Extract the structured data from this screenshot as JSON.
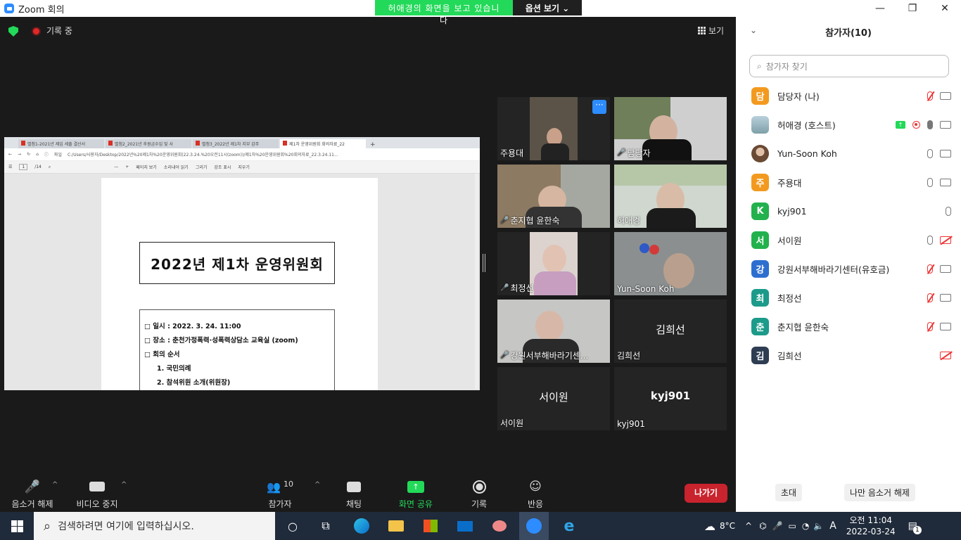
{
  "window": {
    "title": "Zoom 회의",
    "minimize": "—",
    "restore": "❐",
    "close": "✕"
  },
  "share_banner": {
    "viewing": "허애경의 화면을 보고 있습니다",
    "options": "옵션 보기 ⌄"
  },
  "status": {
    "recording": "기록 중",
    "view": "보기"
  },
  "shared_doc": {
    "tabs": [
      "별첨1-2021년 제입 세출 결산서",
      "별첨2_2021년 후원금수입 및 사",
      "별첨3_2022년 제1차 지부 감주",
      "제1차 운영위원회 회의자료_22"
    ],
    "address": "C:/Users/사용자/Desktop/2022년%20제1차%20운영위원회(22.3.24.%20오전11시(zoom))/제1차%20운영위원회%20회의자료_22.3.24.11...",
    "file_label": "파일",
    "page_num": "1",
    "page_total": "/14",
    "tools": [
      "페이지 보기",
      "소리내어 읽기",
      "그리기",
      "강조 표시",
      "지우기"
    ],
    "title": "2022년 제1차 운영위원회",
    "lines": [
      {
        "text": "□ 일시 : 2022. 3. 24. 11:00",
        "indent": false
      },
      {
        "text": "□ 장소 : 춘천가정폭력·성폭력상담소 교육실 (zoom)",
        "indent": false
      },
      {
        "text": "□ 회의 순서",
        "indent": false
      },
      {
        "text": "1. 국민의례",
        "indent": true
      },
      {
        "text": "2. 참석위원 소개(위원장)",
        "indent": true
      }
    ]
  },
  "tiles": [
    {
      "name": "주용대",
      "muted": false
    },
    {
      "name": "담당자",
      "muted": true
    },
    {
      "name": "춘지협 윤한숙",
      "muted": true
    },
    {
      "name": "허애경",
      "muted": false
    },
    {
      "name": "최정선",
      "muted": true
    },
    {
      "name": "Yun-Soon Koh",
      "muted": false
    },
    {
      "name": "강원서부해바라기센...",
      "muted": true
    },
    {
      "name": "김희선",
      "center": "김희선",
      "muted": false
    },
    {
      "name": "서이원",
      "center": "서이원",
      "muted": false
    },
    {
      "name": "kyj901",
      "center": "kyj901",
      "muted": false
    }
  ],
  "toolbar": {
    "mute": "음소거 해제",
    "video": "비디오 중지",
    "participants": "참가자",
    "participants_count": "10",
    "chat": "채팅",
    "share": "화면 공유",
    "record": "기록",
    "reactions": "반응",
    "leave": "나가기"
  },
  "panel": {
    "title": "참가자(10)",
    "search_placeholder": "참가자 찾기",
    "participants": [
      {
        "initial": "담",
        "name": "담당자 (나)",
        "color": "#f29a1f",
        "mic": "muted",
        "cam": "on"
      },
      {
        "initial": "",
        "name": "허애경 (호스트)",
        "color": "#8fb3c9",
        "mic": "on",
        "cam": "on",
        "share": true,
        "rec": true
      },
      {
        "initial": "",
        "name": "Yun-Soon Koh",
        "color": "#7a5a40",
        "mic": "on",
        "cam": "on"
      },
      {
        "initial": "주",
        "name": "주용대",
        "color": "#f29a1f",
        "mic": "on",
        "cam": "on"
      },
      {
        "initial": "K",
        "name": "kyj901",
        "color": "#23b14d",
        "mic": "on",
        "cam": "none"
      },
      {
        "initial": "서",
        "name": "서이원",
        "color": "#23b14d",
        "mic": "on",
        "cam": "off"
      },
      {
        "initial": "강",
        "name": "강원서부해바라기센터(유호금)",
        "color": "#2d6fcf",
        "mic": "muted",
        "cam": "on"
      },
      {
        "initial": "최",
        "name": "최정선",
        "color": "#1c9a8a",
        "mic": "muted",
        "cam": "on"
      },
      {
        "initial": "춘",
        "name": "춘지협 윤한숙",
        "color": "#1c9a8a",
        "mic": "muted",
        "cam": "on"
      },
      {
        "initial": "김",
        "name": "김희선",
        "color": "#2e3d52",
        "mic": "none",
        "cam": "off"
      }
    ],
    "invite": "초대",
    "unmute_me": "나만 음소거 해제"
  },
  "taskbar": {
    "search_placeholder": "검색하려면 여기에 입력하십시오.",
    "weather": "8°C",
    "ime": "A",
    "time_period": "오전 11:04",
    "date": "2022-03-24",
    "notif_count": "1"
  }
}
